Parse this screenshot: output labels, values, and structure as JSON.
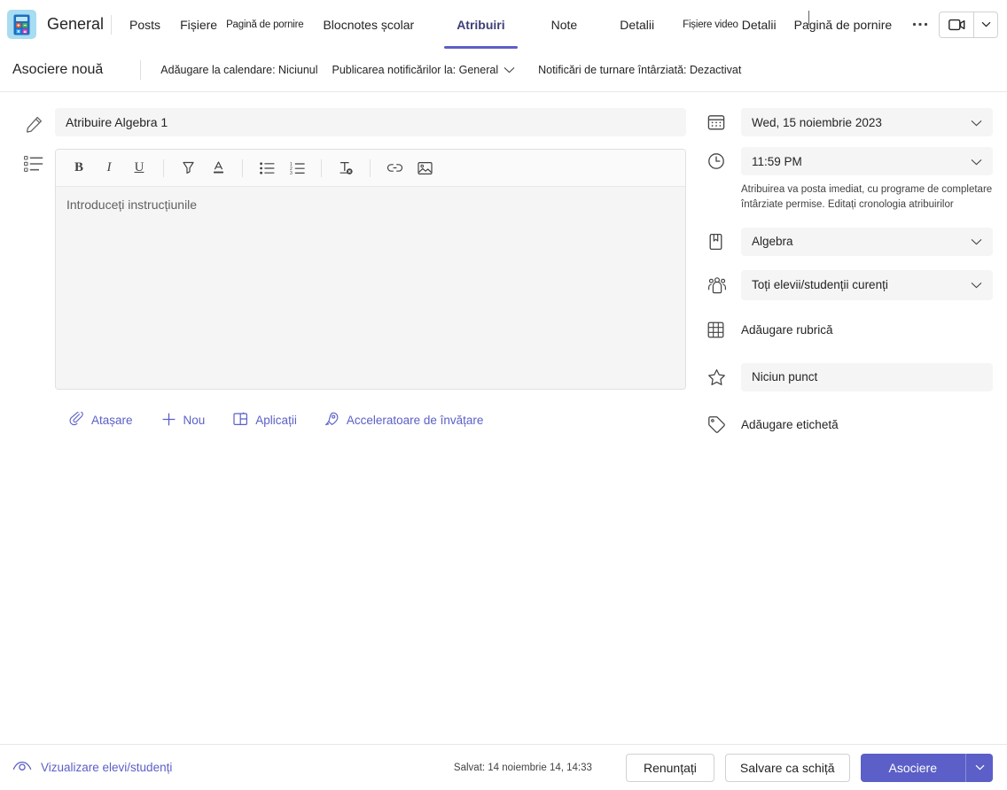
{
  "header": {
    "team_name": "General",
    "logo_icon": "calculator-icon",
    "tabs": [
      {
        "label": "Posts",
        "active": false
      },
      {
        "label": "Fișiere",
        "active": false
      },
      {
        "label": "Pagină de pornire",
        "active": false
      },
      {
        "label": "Blocnotes școlar",
        "active": false
      },
      {
        "label": "Atribuiri",
        "active": true
      },
      {
        "label": "Note",
        "active": false
      },
      {
        "label": "Detalii",
        "active": false
      },
      {
        "label": "Fișiere video",
        "active": false
      },
      {
        "label": "Detalii",
        "active": false
      },
      {
        "label": "Pagină de pornire",
        "active": false
      }
    ],
    "more_label": "···",
    "more_icon": "more-horizontal-icon",
    "meet_icon": "video-camera-icon",
    "meet_chevron_icon": "chevron-down-icon"
  },
  "subbar": {
    "title": "Asociere nouă",
    "add_to_calendar": "Adăugare la calendare: Niciunul",
    "post_notifications": "Publicarea notificărilor la: General",
    "late_turnin": "Notificări de turnare întârziată: Dezactivat",
    "chevron_icon": "chevron-down-icon"
  },
  "form": {
    "title_icon": "pencil-icon",
    "title_value": "Atribuire Algebra 1",
    "instructions_icon": "list-lines-icon",
    "instructions_placeholder": "Introduceți instrucțiunile",
    "toolbar": [
      {
        "name": "bold-icon",
        "label": "B"
      },
      {
        "name": "italic-icon",
        "label": "I"
      },
      {
        "name": "underline-icon",
        "label": "U"
      },
      {
        "name": "highlight-icon",
        "label": ""
      },
      {
        "name": "font-color-icon",
        "label": ""
      },
      {
        "name": "bulleted-list-icon",
        "label": ""
      },
      {
        "name": "numbered-list-icon",
        "label": ""
      },
      {
        "name": "clear-formatting-icon",
        "label": ""
      },
      {
        "name": "link-icon",
        "label": ""
      },
      {
        "name": "image-icon",
        "label": ""
      }
    ],
    "attachments": [
      {
        "icon": "paperclip-icon",
        "label": "Atașare"
      },
      {
        "icon": "plus-icon",
        "label": "Nou"
      },
      {
        "icon": "apps-grid-icon",
        "label": "Aplicații"
      },
      {
        "icon": "rocket-icon",
        "label": "Acceleratoare de învățare"
      }
    ]
  },
  "settings": {
    "due_date_icon": "calendar-icon",
    "due_date": "Wed, 15 noiembrie 2023",
    "due_time_icon": "clock-icon",
    "due_time": "11:59 PM",
    "schedule_help": "Atribuirea va posta imediat, cu programe de completare întârziate permise.",
    "schedule_help_link": "Editați cronologia atribuirilor",
    "class_icon": "book-icon",
    "class_value": "Algebra",
    "students_icon": "people-icon",
    "students_value": "Toți elevii/studenții curenți",
    "rubric_icon": "grid-table-icon",
    "rubric_label": "Adăugare rubrică",
    "points_icon": "star-icon",
    "points_value": "Niciun punct",
    "tag_icon": "tag-icon",
    "tag_label": "Adăugare etichetă",
    "chevron_icon": "chevron-down-icon"
  },
  "footer": {
    "preview_icon": "eye-icon",
    "preview_label": "Vizualizare elevi/studenți",
    "saved_text": "Salvat: 14 noiembrie 14, 14:33",
    "discard_label": "Renunțați",
    "save_draft_label": "Salvare ca schiță",
    "assign_label": "Asociere",
    "assign_chevron_icon": "chevron-down-icon"
  },
  "colors": {
    "accent": "#5b5fc7",
    "field_bg": "#f5f5f5",
    "text": "#242424",
    "logo_bg": "#a8dcf0"
  }
}
